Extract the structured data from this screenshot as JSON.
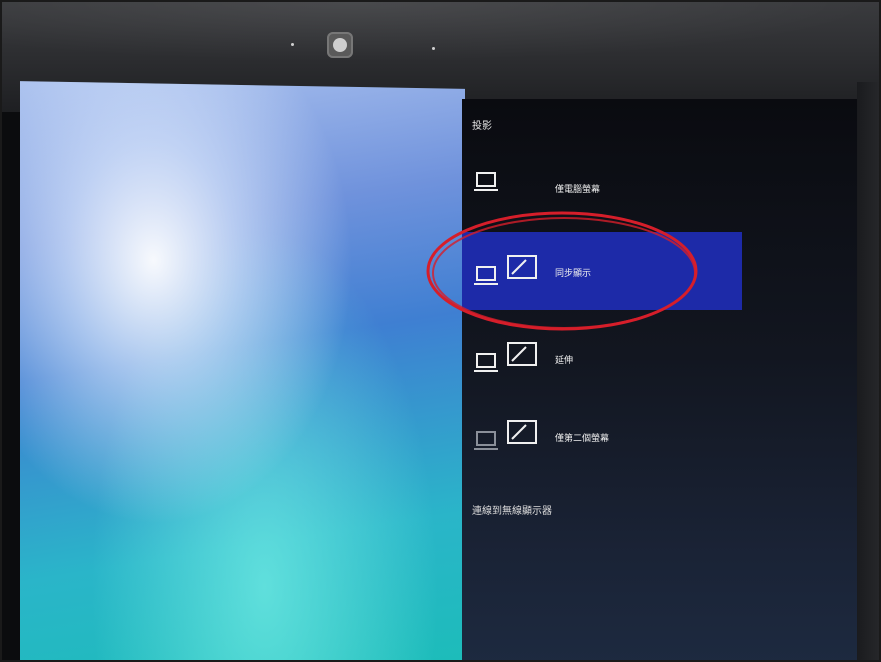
{
  "flyout": {
    "title": "投影",
    "options": [
      {
        "label": "僅電腦螢幕",
        "icon": "pc-screen-only-icon",
        "selected": false
      },
      {
        "label": "同步顯示",
        "icon": "duplicate-icon",
        "selected": true
      },
      {
        "label": "延伸",
        "icon": "extend-icon",
        "selected": false
      },
      {
        "label": "僅第二個螢幕",
        "icon": "second-screen-only-icon",
        "selected": false
      }
    ],
    "wireless_link": "連線到無線顯示器"
  },
  "colors": {
    "selected_bg": "#1d2aa8",
    "flyout_bg": "#0a0b10",
    "annotation_ring": "#d61e2a"
  }
}
